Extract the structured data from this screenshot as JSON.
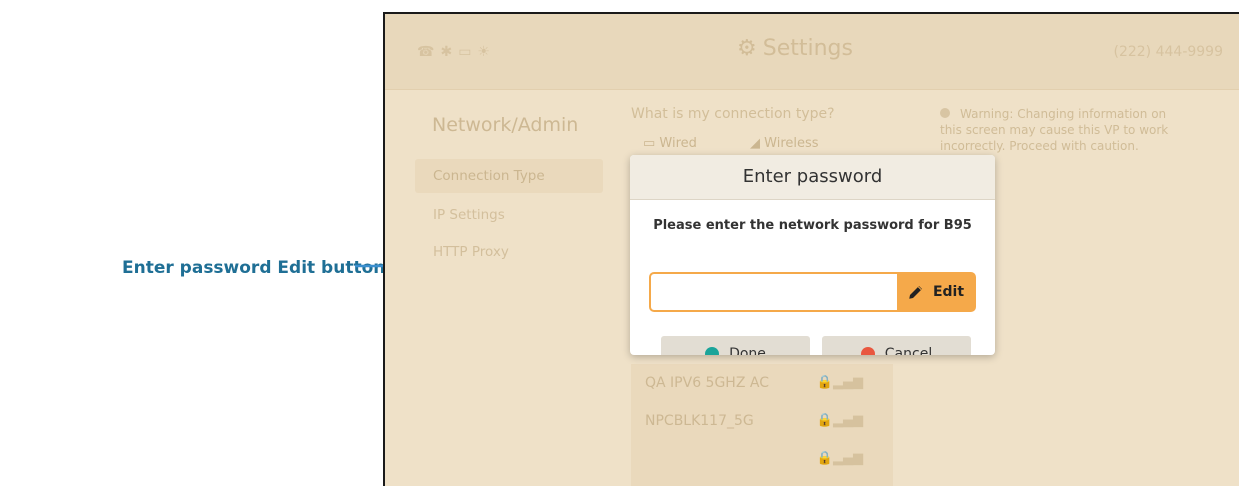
{
  "callout": {
    "label": "Enter password Edit button"
  },
  "topbar": {
    "title": "Settings",
    "phone": "(222) 444-9999",
    "status_icons": [
      "phone-icon",
      "bluetooth-icon",
      "camera-icon",
      "light-icon"
    ]
  },
  "sidebar": {
    "title": "Network/Admin",
    "items": [
      {
        "label": "Connection Type",
        "active": true
      },
      {
        "label": "IP Settings",
        "active": false
      },
      {
        "label": "HTTP Proxy",
        "active": false
      }
    ]
  },
  "connection": {
    "question": "What is my connection type?",
    "options": [
      "Wired",
      "Wireless"
    ]
  },
  "warning": {
    "text": "Warning: Changing information on this screen may cause this VP to work incorrectly. Proceed with caution."
  },
  "networks": [
    {
      "name": "QA IPV6 5GHZ AC"
    },
    {
      "name": "NPCBLK117_5G"
    },
    {
      "name": ""
    }
  ],
  "modal": {
    "title": "Enter password",
    "message": "Please enter the network password for B95",
    "password_value": "",
    "edit_label": "Edit",
    "done_label": "Done",
    "cancel_label": "Cancel",
    "colors": {
      "accent": "#f5a94a",
      "done_dot": "#1aa49a",
      "cancel_dot": "#e9573f"
    }
  }
}
